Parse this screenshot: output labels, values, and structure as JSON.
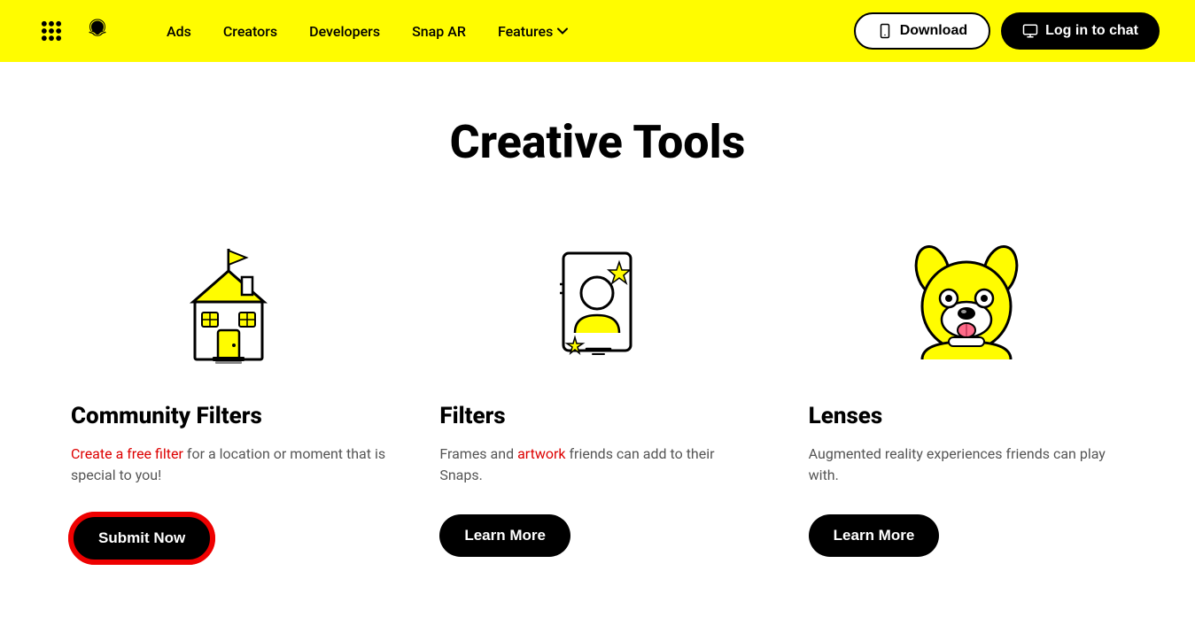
{
  "header": {
    "nav": {
      "ads": "Ads",
      "creators": "Creators",
      "developers": "Developers",
      "snapar": "Snap AR",
      "features": "Features"
    },
    "download_label": "Download",
    "login_label": "Log in to chat"
  },
  "main": {
    "title": "Creative Tools",
    "cards": [
      {
        "id": "community-filters",
        "title": "Community Filters",
        "desc_part1": "Create a free filter for a location or moment that is special to you!",
        "btn_label": "Submit Now"
      },
      {
        "id": "filters",
        "title": "Filters",
        "desc": "Frames and artwork friends can add to their Snaps.",
        "btn_label": "Learn More"
      },
      {
        "id": "lenses",
        "title": "Lenses",
        "desc": "Augmented reality experiences friends can play with.",
        "btn_label": "Learn More"
      }
    ]
  },
  "colors": {
    "yellow": "#FFFC00",
    "black": "#000000",
    "white": "#ffffff",
    "red_outline": "#dd0000"
  }
}
